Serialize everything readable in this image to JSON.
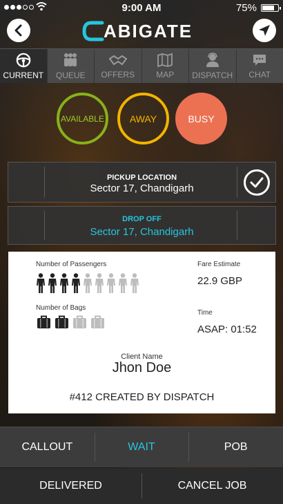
{
  "status_bar": {
    "time": "9:00 AM",
    "battery_percent": "75%",
    "battery_level": 0.75,
    "signal_bars_filled": 3,
    "signal_bars_total": 5
  },
  "header": {
    "logo_text": "ABIGATE",
    "back_icon": "chevron-left-icon",
    "navigate_icon": "navigation-arrow-icon"
  },
  "tabs": [
    {
      "label": "CURRENT",
      "icon": "steering-wheel-icon",
      "active": true
    },
    {
      "label": "QUEUE",
      "icon": "people-queue-icon",
      "active": false
    },
    {
      "label": "OFFERS",
      "icon": "handshake-icon",
      "active": false
    },
    {
      "label": "MAP",
      "icon": "map-icon",
      "active": false
    },
    {
      "label": "DISPATCH",
      "icon": "dispatcher-icon",
      "active": false
    },
    {
      "label": "CHAT",
      "icon": "chat-bubble-icon",
      "active": false
    }
  ],
  "driver_status": {
    "available": "AVAILABLE",
    "away": "AWAY",
    "busy": "BUSY"
  },
  "pickup": {
    "title": "PICKUP LOCATION",
    "value": "Sector 17, Chandigarh"
  },
  "dropoff": {
    "title": "DROP OFF",
    "value": "Sector 17, Chandigarh"
  },
  "details": {
    "passengers_label": "Number of Passengers",
    "passengers_selected": 4,
    "passengers_total": 9,
    "bags_label": "Number of Bags",
    "bags_selected": 2,
    "bags_total": 4,
    "fare_label": "Fare Estimate",
    "fare_value": "22.9 GBP",
    "time_label": "Time",
    "time_value": "ASAP: 01:52",
    "client_label": "Client Name",
    "client_name": "Jhon Doe",
    "created_text": "#412  CREATED BY DISPATCH"
  },
  "actions_row1": [
    "CALLOUT",
    "WAIT",
    "POB"
  ],
  "actions_row2": [
    "DELIVERED",
    "CANCEL JOB"
  ],
  "colors": {
    "accent_cyan": "#26c6e0",
    "available_green": "#86b21a",
    "away_yellow": "#f2b400",
    "busy_orange": "#ec7152"
  }
}
